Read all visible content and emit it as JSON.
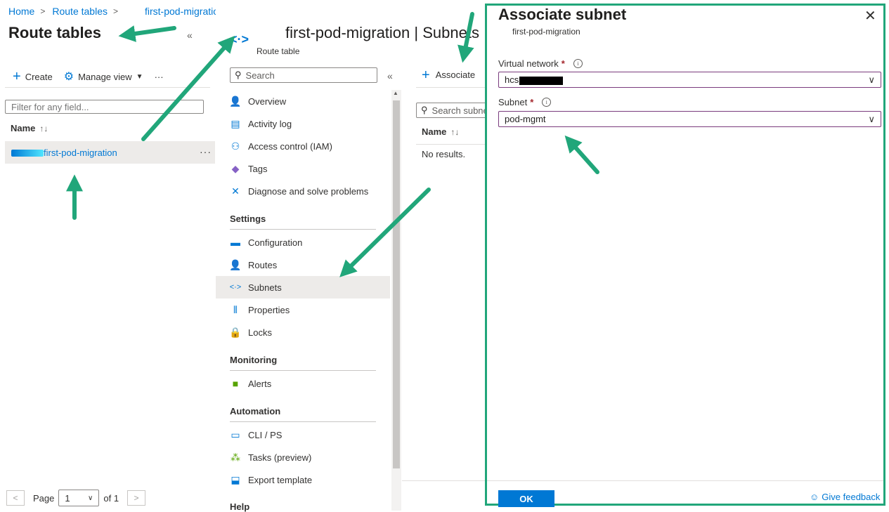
{
  "breadcrumb": {
    "home": "Home",
    "route_tables": "Route tables",
    "current": "first-pod-migration"
  },
  "left_pane": {
    "title": "Route tables",
    "collapse": "«",
    "toolbar": {
      "create": "Create",
      "manage_view": "Manage view",
      "more": "···"
    },
    "filter_placeholder": "Filter for any field...",
    "column_name": "Name",
    "sort_icon": "↑↓",
    "row": {
      "name": "first-pod-migration",
      "more": "···"
    },
    "pager": {
      "prev": "<",
      "page_label": "Page",
      "page_value": "1",
      "of_label": "of 1",
      "next": ">"
    }
  },
  "resource": {
    "title": "first-pod-migration | Subnets",
    "subtitle": "Route table",
    "icon": "<·>"
  },
  "menu": {
    "search_placeholder": "Search",
    "collapse": "«",
    "items_top": [
      {
        "label": "Overview",
        "icon": "overview-icon"
      },
      {
        "label": "Activity log",
        "icon": "activity-log-icon"
      },
      {
        "label": "Access control (IAM)",
        "icon": "iam-icon"
      },
      {
        "label": "Tags",
        "icon": "tag-icon"
      },
      {
        "label": "Diagnose and solve problems",
        "icon": "wrench-icon"
      }
    ],
    "settings_title": "Settings",
    "settings_items": [
      {
        "label": "Configuration",
        "icon": "configuration-icon"
      },
      {
        "label": "Routes",
        "icon": "routes-icon"
      },
      {
        "label": "Subnets",
        "icon": "subnets-icon"
      },
      {
        "label": "Properties",
        "icon": "properties-icon"
      },
      {
        "label": "Locks",
        "icon": "lock-icon"
      }
    ],
    "monitoring_title": "Monitoring",
    "monitoring_items": [
      {
        "label": "Alerts",
        "icon": "alerts-icon"
      }
    ],
    "automation_title": "Automation",
    "automation_items": [
      {
        "label": "CLI / PS",
        "icon": "cli-icon"
      },
      {
        "label": "Tasks (preview)",
        "icon": "tasks-icon"
      },
      {
        "label": "Export template",
        "icon": "export-icon"
      }
    ],
    "help_title": "Help"
  },
  "content": {
    "associate": "Associate",
    "search_placeholder": "Search subnets",
    "column_name": "Name",
    "no_results": "No results."
  },
  "dialog": {
    "title": "Associate subnet",
    "subtitle": "first-pod-migration",
    "close": "✕",
    "vnet_label": "Virtual network",
    "vnet_value": "hcs",
    "subnet_label": "Subnet",
    "subnet_value": "pod-mgmt",
    "required": "*",
    "ok": "OK",
    "feedback": "Give feedback"
  }
}
